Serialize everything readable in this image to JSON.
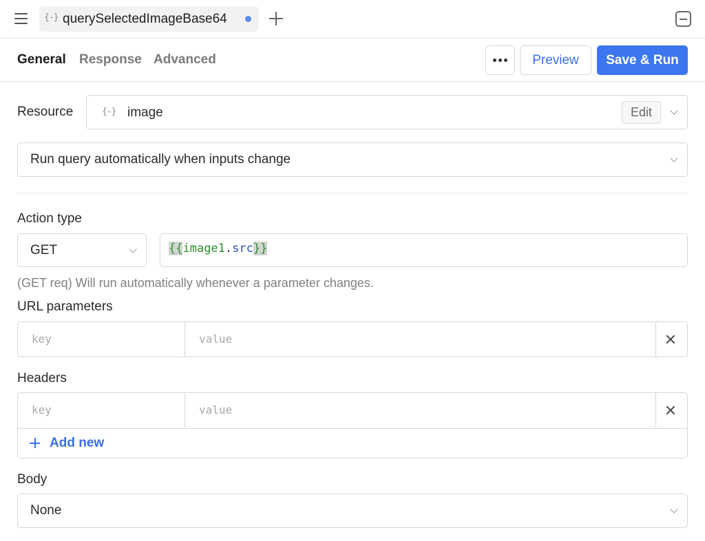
{
  "tabbar": {
    "menu_icon": "hamburger-icon",
    "tab": {
      "icon": "{-}",
      "label": "querySelectedImageBase64",
      "unsaved": true
    },
    "add_icon": "plus-icon",
    "collapse_icon": "minus-square-icon"
  },
  "toolbar": {
    "tabs": [
      {
        "label": "General",
        "active": true
      },
      {
        "label": "Response",
        "active": false
      },
      {
        "label": "Advanced",
        "active": false
      }
    ],
    "more_icon": "ellipsis-icon",
    "preview_label": "Preview",
    "save_label": "Save & Run"
  },
  "form": {
    "resource": {
      "label": "Resource",
      "icon": "{-}",
      "value": "image",
      "edit_label": "Edit"
    },
    "run_mode": {
      "value": "Run query automatically when inputs change"
    },
    "action_type": {
      "label": "Action type",
      "method": "GET",
      "url": {
        "brace_open": "{{",
        "var": "image1",
        "dot": ".",
        "prop": "src",
        "brace_close": "}}"
      }
    },
    "hint": "(GET req) Will run automatically whenever a parameter changes.",
    "url_params": {
      "label": "URL parameters",
      "key_placeholder": "key",
      "value_placeholder": "value"
    },
    "headers": {
      "label": "Headers",
      "key_placeholder": "key",
      "value_placeholder": "value",
      "add_label": "Add new"
    },
    "body": {
      "label": "Body",
      "value": "None"
    }
  },
  "colors": {
    "accent": "#3d77f0",
    "link": "#3a6fe8",
    "unsaved_dot": "#5a8def"
  }
}
